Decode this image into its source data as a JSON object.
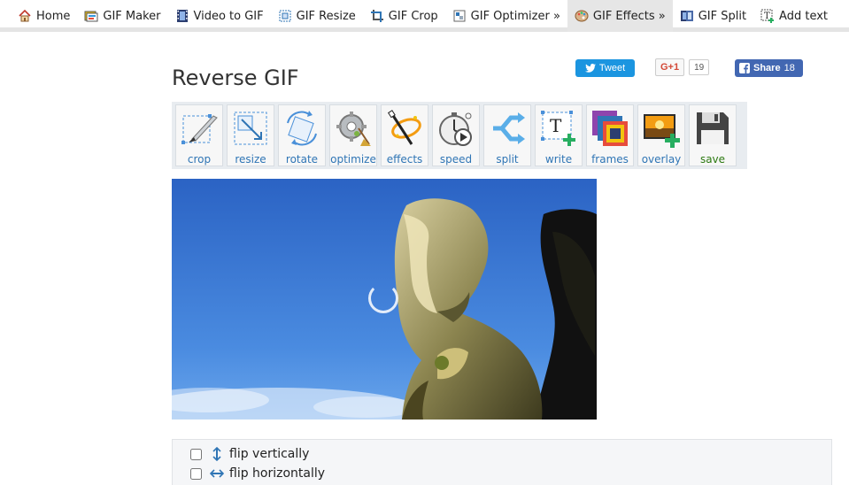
{
  "nav": [
    {
      "label": "Home",
      "icon": "home-icon"
    },
    {
      "label": "GIF Maker",
      "icon": "gif-maker-icon"
    },
    {
      "label": "Video to GIF",
      "icon": "film-icon"
    },
    {
      "label": "GIF Resize",
      "icon": "resize-icon"
    },
    {
      "label": "GIF Crop",
      "icon": "crop-icon"
    },
    {
      "label": "GIF Optimizer »",
      "icon": "optimizer-icon"
    },
    {
      "label": "GIF Effects »",
      "icon": "palette-icon",
      "active": true
    },
    {
      "label": "GIF Split",
      "icon": "split-icon"
    },
    {
      "label": "Add text",
      "icon": "text-icon"
    }
  ],
  "page": {
    "title": "Reverse GIF"
  },
  "share": {
    "tweet_label": "Tweet",
    "gplus_label": "G+1",
    "gplus_count": "19",
    "facebook_label": "Share",
    "facebook_count": "18"
  },
  "toolbar": [
    {
      "label": "crop",
      "icon": "crop-tool-icon"
    },
    {
      "label": "resize",
      "icon": "resize-tool-icon"
    },
    {
      "label": "rotate",
      "icon": "rotate-tool-icon"
    },
    {
      "label": "optimize",
      "icon": "optimize-tool-icon"
    },
    {
      "label": "effects",
      "icon": "effects-tool-icon"
    },
    {
      "label": "speed",
      "icon": "speed-tool-icon"
    },
    {
      "label": "split",
      "icon": "split-tool-icon"
    },
    {
      "label": "write",
      "icon": "write-tool-icon"
    },
    {
      "label": "frames",
      "icon": "frames-tool-icon"
    },
    {
      "label": "overlay",
      "icon": "overlay-tool-icon"
    },
    {
      "label": "save",
      "icon": "save-tool-icon"
    }
  ],
  "options": {
    "flip_vertical_label": "flip vertically",
    "flip_horizontal_label": "flip horizontally"
  },
  "colors": {
    "link": "#2f75b5",
    "save": "#2d7a12",
    "twitter": "#1b95e0",
    "facebook": "#4267b2",
    "sky": "#3a78d2"
  }
}
